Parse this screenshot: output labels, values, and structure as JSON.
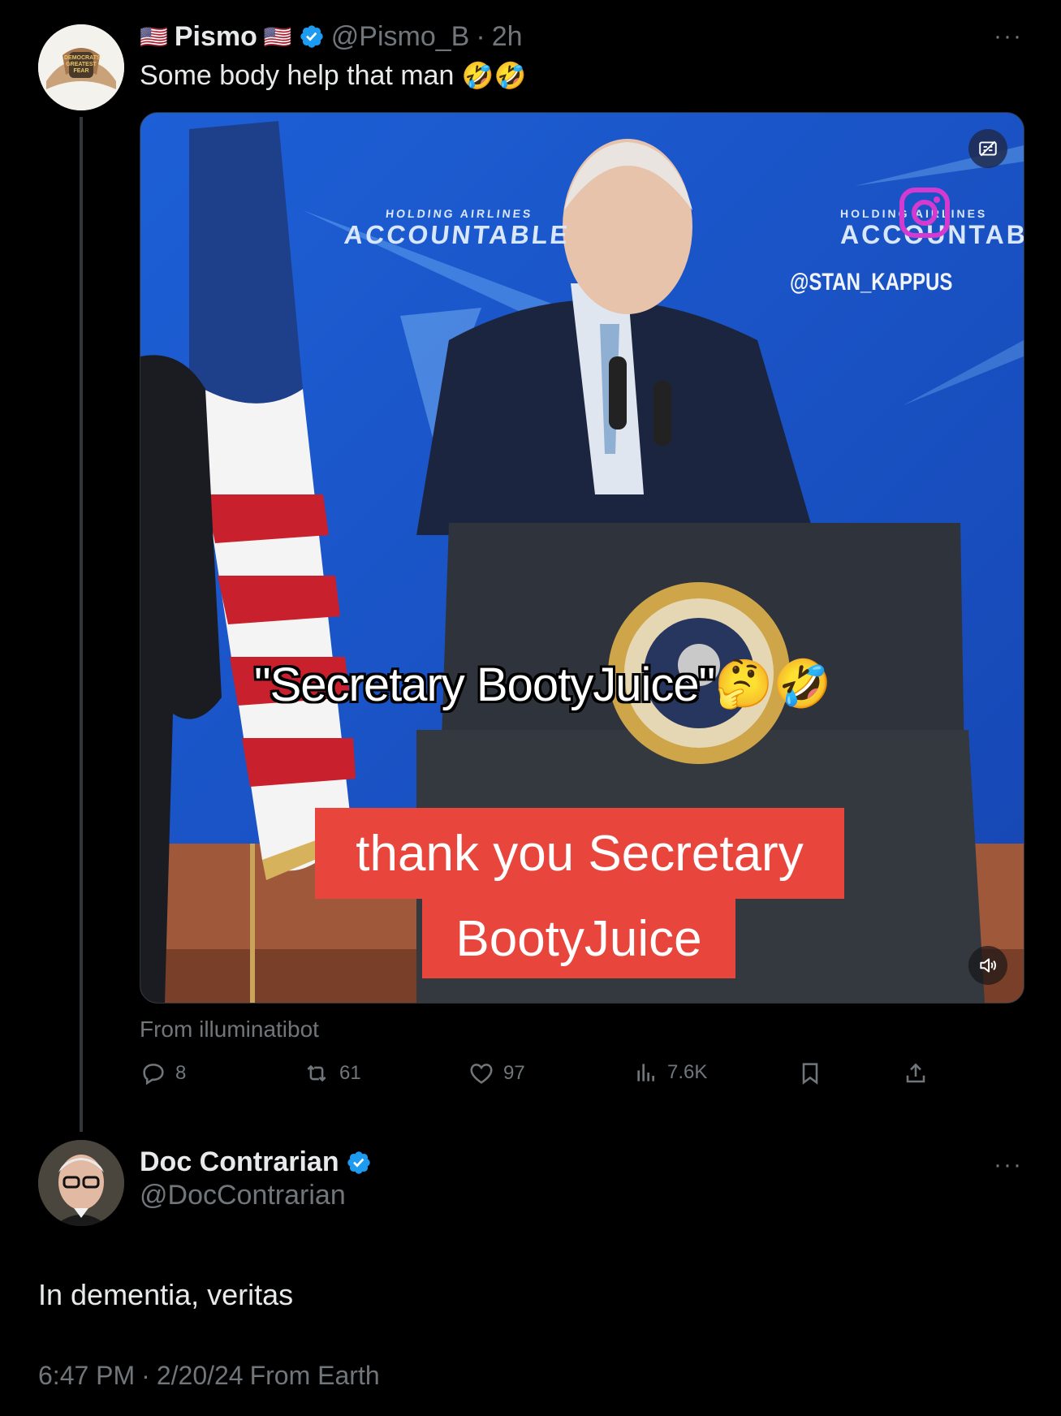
{
  "post1": {
    "name": "Pismo",
    "handle": "@Pismo_B",
    "separator": "·",
    "time": "2h",
    "text": "Some body help that man",
    "text_emoji": "🤣🤣",
    "flag_emoji": "🇺🇸",
    "avatar_text": [
      "DEMOCRATS",
      "GREATEST",
      "FEAR"
    ],
    "more_label": "···",
    "media": {
      "banner_left_small": "HOLDING AIRLINES",
      "banner_left": "ACCOUNTABLE",
      "banner_right_small": "HOLDING AIRLINES",
      "banner_right": "ACCOUNTAB",
      "watermark": "@STAN_KAPPUS",
      "caption_quote": "\"Secretary BootyJuice\"",
      "caption_emoji": "🤔🤣",
      "subtitle_line1": "thank you Secretary",
      "subtitle_line2": "BootyJuice"
    },
    "source": "From illuminatibot",
    "actions": {
      "replies": "8",
      "reposts": "61",
      "likes": "97",
      "views": "7.6K"
    }
  },
  "post2": {
    "name": "Doc Contrarian",
    "handle": "@DocContrarian",
    "more_label": "···",
    "text": "In dementia, veritas",
    "time": "6:47 PM",
    "separator": "·",
    "date": "2/20/24",
    "source": "From Earth"
  },
  "colors": {
    "background": "#000000",
    "text": "#e7e9ea",
    "muted": "#71767b",
    "verified": "#1d9bf0",
    "subtitle_bg": "#e8453c"
  }
}
